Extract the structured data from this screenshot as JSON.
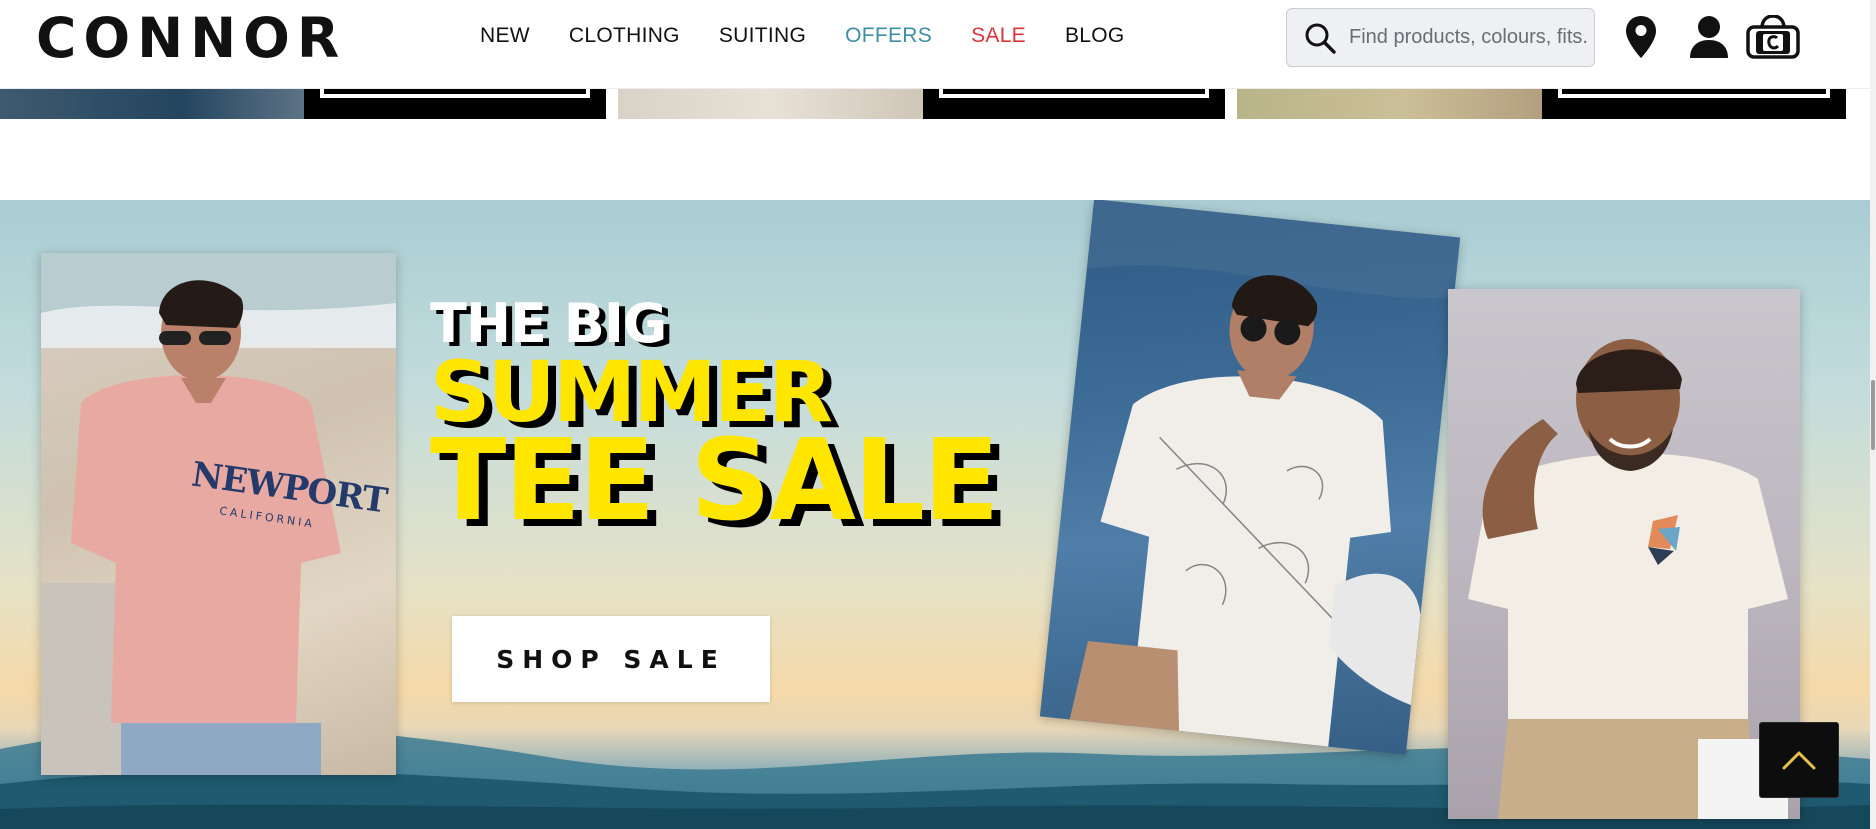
{
  "brand": {
    "logo_text": "CONNOR"
  },
  "nav": {
    "items": [
      {
        "label": "NEW"
      },
      {
        "label": "CLOTHING"
      },
      {
        "label": "SUITING"
      },
      {
        "label": "OFFERS",
        "color": "#3f8fa3"
      },
      {
        "label": "SALE",
        "color": "#d9353a"
      },
      {
        "label": "BLOG"
      }
    ]
  },
  "search": {
    "placeholder": "Find products, colours, fits.."
  },
  "header_icons": [
    "search-icon",
    "location-pin-icon",
    "account-icon",
    "shopping-bag-icon"
  ],
  "hero": {
    "headline_line1": "THE BIG",
    "headline_line2": "SUMMER",
    "headline_line3": "TEE SALE",
    "cta_label": "SHOP SALE",
    "left_photo_shirt_text": "NEWPORT",
    "left_photo_shirt_subtext": "CALIFORNIA"
  },
  "colors": {
    "accent_yellow": "#ffe600",
    "offers_teal": "#3f8fa3",
    "sale_red": "#d9353a",
    "text_dark": "#111111"
  },
  "back_to_top": {
    "icon": "chevron-up-icon"
  }
}
